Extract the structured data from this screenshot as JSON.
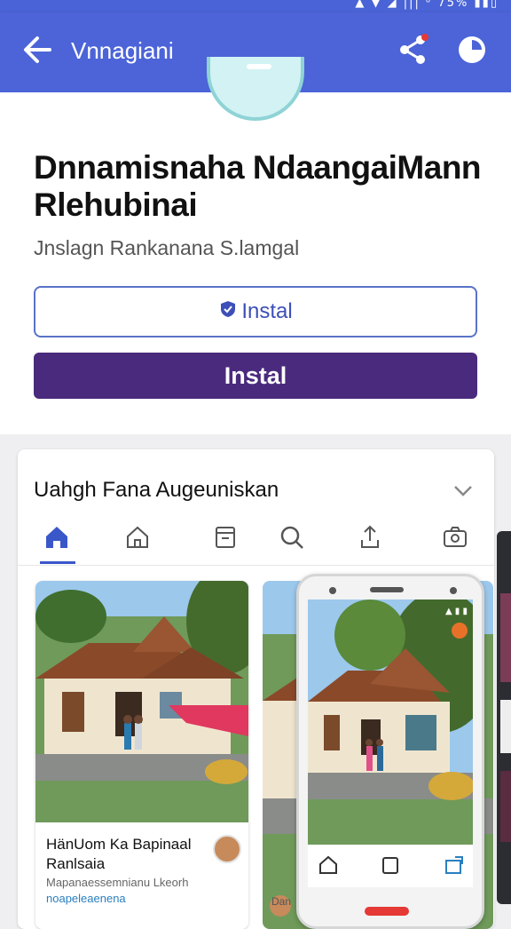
{
  "status_bar": {
    "text": "▲ ▼ ◢ ||| ᵒ 75% ▮▮▯"
  },
  "app_bar": {
    "title": "Vnnagiani",
    "icons": [
      "back-arrow-icon",
      "share-icon",
      "more-icon"
    ]
  },
  "app": {
    "title": "Dnnamisnaha NdaangaiMann Rlehubinai",
    "subtitle": "Jnslagn Rankanana S.lamgal",
    "outline_button_label": "Instal",
    "filled_button_label": "Instal"
  },
  "card": {
    "title": "Uahgh Fana Augeuniskan",
    "tabs": [
      "home-icon",
      "house-outline-icon",
      "bookmark-icon",
      "search-icon",
      "share-up-icon",
      "camera-icon"
    ],
    "photo_card": {
      "name": "HänUom Ka Bapinaal Ranlsaia",
      "desc": "Mapanaessemnianu Lkeorh",
      "link": "noapeleaenena"
    },
    "footer_text": "Dan"
  },
  "colors": {
    "accent": "#4c64d8",
    "install": "#4a2a7d"
  }
}
